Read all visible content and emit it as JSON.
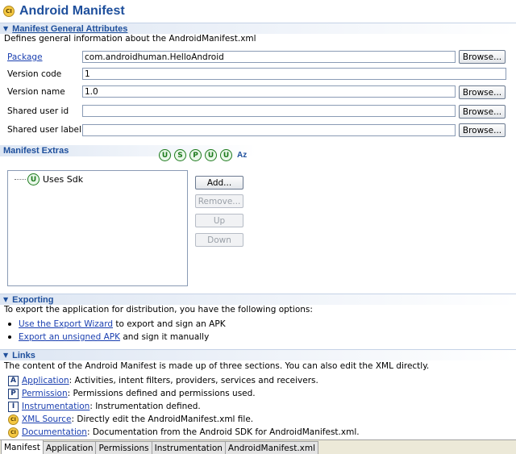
{
  "header": {
    "title": "Android Manifest",
    "icon": "android-manifest-icon"
  },
  "general": {
    "title": "Manifest General Attributes",
    "description": "Defines general information about the AndroidManifest.xml",
    "fields": [
      {
        "label": "Package",
        "value": "com.androidhuman.HelloAndroid",
        "has_browse": true,
        "is_link": true
      },
      {
        "label": "Version code",
        "value": "1",
        "has_browse": false,
        "is_link": false
      },
      {
        "label": "Version name",
        "value": "1.0",
        "has_browse": true,
        "is_link": false
      },
      {
        "label": "Shared user id",
        "value": "",
        "has_browse": true,
        "is_link": false
      },
      {
        "label": "Shared user label",
        "value": "",
        "has_browse": true,
        "is_link": false
      }
    ],
    "browse_label": "Browse..."
  },
  "extras": {
    "title": "Manifest Extras",
    "toolbar_icons": [
      "U",
      "S",
      "P",
      "U",
      "U"
    ],
    "sort_label": "Az",
    "tree_items": [
      {
        "icon_letter": "U",
        "label": "Uses Sdk"
      }
    ],
    "buttons": {
      "add": "Add...",
      "remove": "Remove...",
      "up": "Up",
      "down": "Down"
    }
  },
  "exporting": {
    "title": "Exporting",
    "description": "To export the application for distribution, you have the following options:",
    "options": [
      {
        "link": "Use the Export Wizard",
        "text": " to export and sign an APK"
      },
      {
        "link": "Export an unsigned APK",
        "text": " and sign it manually"
      }
    ]
  },
  "links": {
    "title": "Links",
    "description": "The content of the Android Manifest is made up of three sections. You can also edit the XML directly.",
    "items": [
      {
        "icon": "A",
        "link": "Application",
        "text": ": Activities, intent filters, providers, services and receivers."
      },
      {
        "icon": "P",
        "link": "Permission",
        "text": ": Permissions defined and permissions used."
      },
      {
        "icon": "I",
        "link": "Instrumentation",
        "text": ": Instrumentation defined."
      },
      {
        "icon": "app",
        "link": "XML Source",
        "text": ": Directly edit the AndroidManifest.xml file."
      },
      {
        "icon": "app",
        "link": "Documentation",
        "text": ": Documentation from the Android SDK for AndroidManifest.xml."
      }
    ]
  },
  "tabs": [
    {
      "label": "Manifest",
      "active": true
    },
    {
      "label": "Application",
      "active": false
    },
    {
      "label": "Permissions",
      "active": false
    },
    {
      "label": "Instrumentation",
      "active": false
    },
    {
      "label": "AndroidManifest.xml",
      "active": false
    }
  ]
}
